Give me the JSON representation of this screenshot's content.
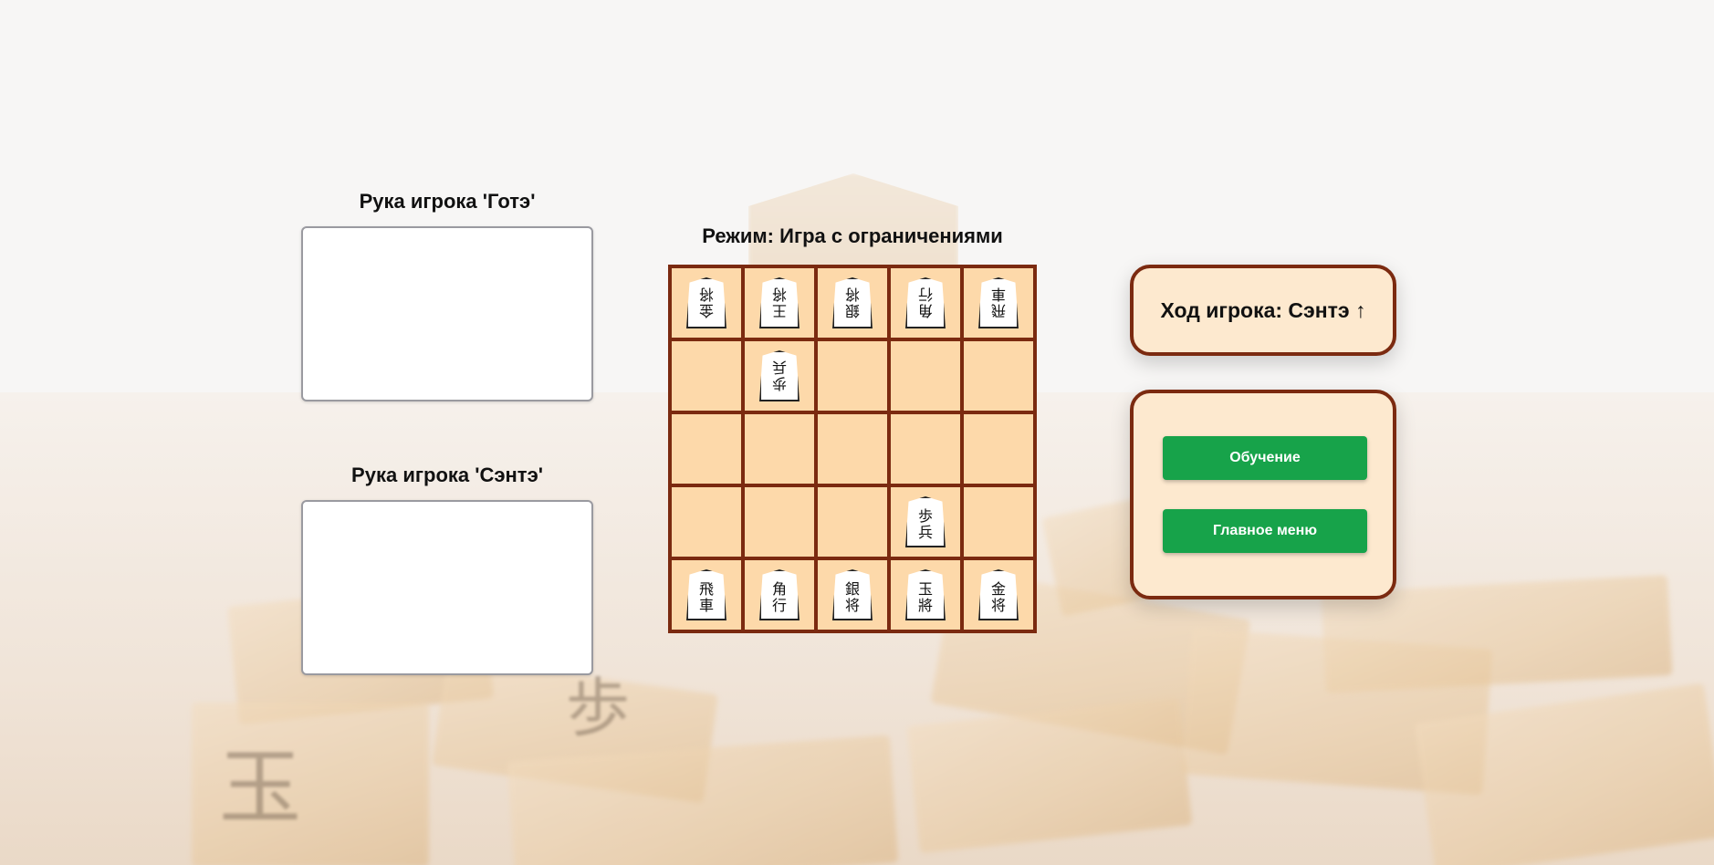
{
  "hands": {
    "gote_title": "Рука игрока 'Готэ'",
    "sente_title": "Рука игрока 'Сэнтэ'"
  },
  "mode": {
    "label": "Режим: Игра с ограничениями"
  },
  "turn": {
    "label": "Ход игрока: Сэнтэ ↑"
  },
  "menu": {
    "tutorial_button": "Обучение",
    "main_menu_button": "Главное меню"
  },
  "board": {
    "size": 5,
    "rows": [
      [
        {
          "top": "金",
          "bottom": "将",
          "owner": "gote"
        },
        {
          "top": "王",
          "bottom": "将",
          "owner": "gote"
        },
        {
          "top": "銀",
          "bottom": "将",
          "owner": "gote"
        },
        {
          "top": "角",
          "bottom": "行",
          "owner": "gote"
        },
        {
          "top": "飛",
          "bottom": "車",
          "owner": "gote"
        }
      ],
      [
        null,
        {
          "top": "歩",
          "bottom": "兵",
          "owner": "gote"
        },
        null,
        null,
        null
      ],
      [
        null,
        null,
        null,
        null,
        null
      ],
      [
        null,
        null,
        null,
        {
          "top": "歩",
          "bottom": "兵",
          "owner": "sente"
        },
        null
      ],
      [
        {
          "top": "飛",
          "bottom": "車",
          "owner": "sente"
        },
        {
          "top": "角",
          "bottom": "行",
          "owner": "sente"
        },
        {
          "top": "銀",
          "bottom": "将",
          "owner": "sente"
        },
        {
          "top": "玉",
          "bottom": "將",
          "owner": "sente"
        },
        {
          "top": "金",
          "bottom": "将",
          "owner": "sente"
        }
      ]
    ]
  },
  "colors": {
    "board_line": "#7b2a10",
    "cell": "#fdd9aa",
    "panel": "#fde9cf",
    "button": "#17a34a"
  }
}
